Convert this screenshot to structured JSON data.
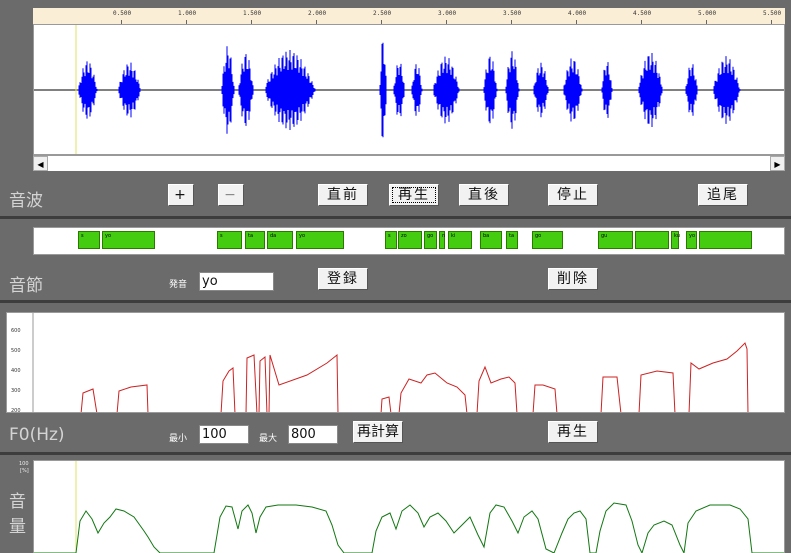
{
  "wave": {
    "label": "音波",
    "ruler_ticks": [
      "0.500",
      "1.000",
      "1.500",
      "2.000",
      "2.500",
      "3.000",
      "3.500",
      "4.000",
      "4.500",
      "5.000",
      "5.500"
    ],
    "buttons": {
      "zoom_in": "+",
      "zoom_out": "−",
      "prev": "直前",
      "play": "再生",
      "next": "直後",
      "stop": "停止",
      "follow": "追尾"
    },
    "scroll_left": "◀",
    "scroll_right": "▶",
    "colors": {
      "wave": "#0000ff",
      "cursor": "#e0e060"
    }
  },
  "syllable": {
    "label": "音節",
    "pronunciation_label": "発音",
    "pronunciation_value": "yo",
    "buttons": {
      "register": "登録",
      "delete": "削除"
    },
    "segments": [
      "s",
      "yo",
      "s",
      "ta",
      "da",
      "yo",
      "s",
      "zo",
      "go",
      "n",
      "ki",
      "ba",
      "ta",
      "go",
      "gu",
      "",
      "ku",
      "yo"
    ],
    "colors": {
      "segment": "#44cc11"
    }
  },
  "f0": {
    "label": "F0(Hz)",
    "min_label": "最小",
    "min_value": "100",
    "max_label": "最大",
    "max_value": "800",
    "buttons": {
      "recalc": "再計算",
      "play": "再生"
    },
    "y_ticks": [
      "600",
      "500",
      "400",
      "300",
      "200"
    ],
    "colors": {
      "line": "#cc2222"
    }
  },
  "volume": {
    "label_1": "音",
    "label_2": "量",
    "y_top": "100",
    "y_unit": "[%]",
    "colors": {
      "line": "#117711"
    }
  }
}
